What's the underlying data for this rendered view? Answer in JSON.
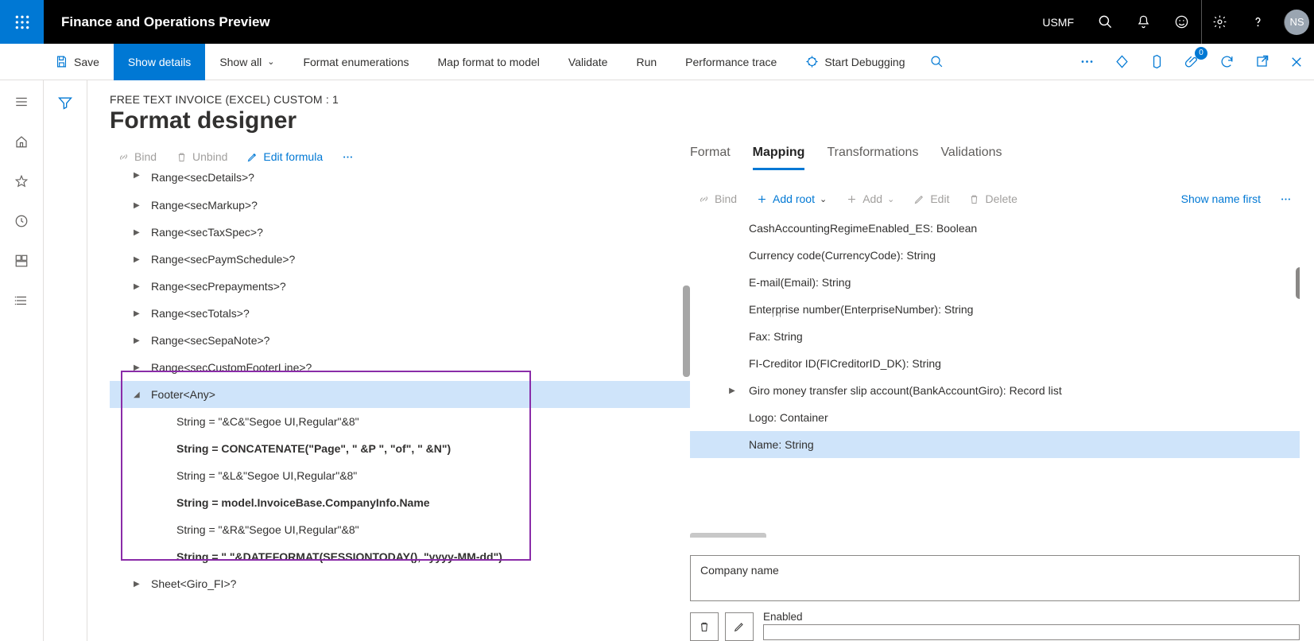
{
  "app_title": "Finance and Operations Preview",
  "company": "USMF",
  "avatar_initials": "NS",
  "cmdbar": {
    "save": "Save",
    "show_details": "Show details",
    "show_all": "Show all",
    "format_enum": "Format enumerations",
    "map_format": "Map format to model",
    "validate": "Validate",
    "run": "Run",
    "perf_trace": "Performance trace",
    "start_debug": "Start Debugging",
    "badge_count": "0"
  },
  "breadcrumb": "FREE TEXT INVOICE (EXCEL) CUSTOM : 1",
  "page_title": "Format designer",
  "left_cmds": {
    "bind": "Bind",
    "unbind": "Unbind",
    "edit_formula": "Edit formula"
  },
  "tree": [
    {
      "label": "Range<secDetails>?",
      "indent": 1,
      "exp": "▶",
      "cut": true
    },
    {
      "label": "Range<secMarkup>?",
      "indent": 1,
      "exp": "▶"
    },
    {
      "label": "Range<secTaxSpec>?",
      "indent": 1,
      "exp": "▶"
    },
    {
      "label": "Range<secPaymSchedule>?",
      "indent": 1,
      "exp": "▶"
    },
    {
      "label": "Range<secPrepayments>?",
      "indent": 1,
      "exp": "▶"
    },
    {
      "label": "Range<secTotals>?",
      "indent": 1,
      "exp": "▶"
    },
    {
      "label": "Range<secSepaNote>?",
      "indent": 1,
      "exp": "▶"
    },
    {
      "label": "Range<secCustomFooterLine>?",
      "indent": 1,
      "exp": "▶"
    },
    {
      "label": "Footer<Any>",
      "indent": 1,
      "exp": "◢",
      "selected": true
    },
    {
      "label": "String = \"&C&\"Segoe UI,Regular\"&8\"",
      "indent": 2
    },
    {
      "label": "String = CONCATENATE(\"Page\", \" &P \", \"of\", \" &N\")",
      "indent": 2,
      "bold": true
    },
    {
      "label": "String = \"&L&\"Segoe UI,Regular\"&8\"",
      "indent": 2
    },
    {
      "label": "String = model.InvoiceBase.CompanyInfo.Name",
      "indent": 2,
      "bold": true
    },
    {
      "label": "String = \"&R&\"Segoe UI,Regular\"&8\"",
      "indent": 2
    },
    {
      "label": "String = \"  \"&DATEFORMAT(SESSIONTODAY(), \"yyyy-MM-dd\")",
      "indent": 2,
      "bold": true
    },
    {
      "label": "Sheet<Giro_FI>?",
      "indent": 1,
      "exp": "▶"
    }
  ],
  "tabs": {
    "format": "Format",
    "mapping": "Mapping",
    "transformations": "Transformations",
    "validations": "Validations"
  },
  "map_cmds": {
    "bind": "Bind",
    "add_root": "Add root",
    "add": "Add",
    "edit": "Edit",
    "delete": "Delete",
    "show_name_first": "Show name first"
  },
  "mapping_list": [
    {
      "label": "CashAccountingRegimeEnabled_ES: Boolean"
    },
    {
      "label": "Currency code(CurrencyCode): String"
    },
    {
      "label": "E-mail(Email): String"
    },
    {
      "label": "Enterprise number(EnterpriseNumber): String"
    },
    {
      "label": "Fax: String"
    },
    {
      "label": "FI-Creditor ID(FICreditorID_DK): String"
    },
    {
      "label": "Giro money transfer slip account(BankAccountGiro): Record list",
      "exp": "▶"
    },
    {
      "label": "Logo: Container"
    },
    {
      "label": "Name: String",
      "selected": true
    }
  ],
  "detail": {
    "field1_value": "Company name",
    "field2_label": "Enabled"
  }
}
